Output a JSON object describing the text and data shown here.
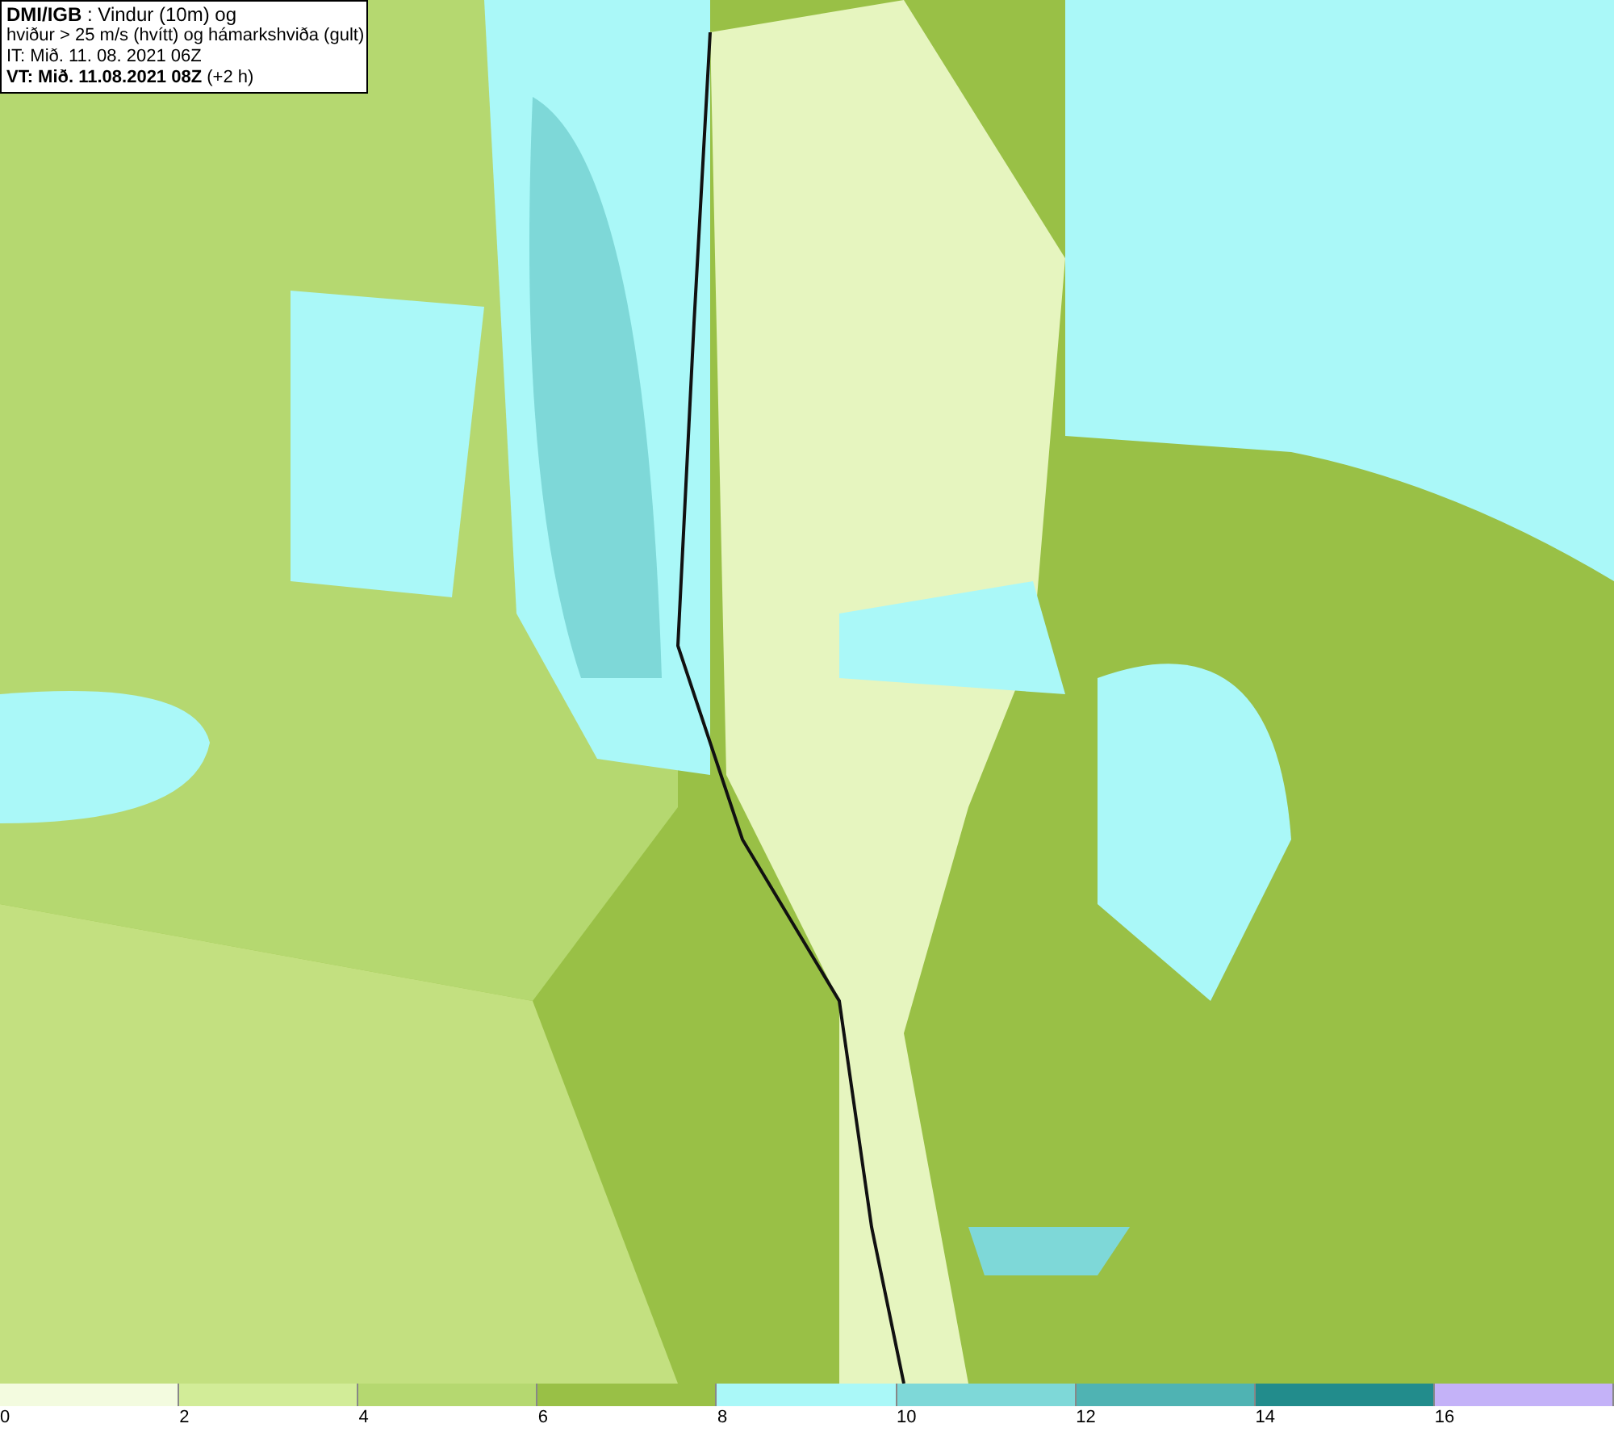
{
  "header": {
    "lines": [
      "**DMI/IGB** : Vindur (10m) og",
      "hviður > 25 m/s (hvítt) og hámarkshviða (gult)",
      "IT: Mið. 11. 08. 2021 06Z",
      "**VT: Mið. 11.08.2021 08Z** (+2 h)"
    ]
  },
  "legend": [
    {
      "label": "0",
      "color": "#f3fbdf"
    },
    {
      "label": "2",
      "color": "#d2ec98"
    },
    {
      "label": "4",
      "color": "#b5d870"
    },
    {
      "label": "6",
      "color": "#99c046"
    },
    {
      "label": "8",
      "color": "#aaf8f8"
    },
    {
      "label": "10",
      "color": "#7ed8d8"
    },
    {
      "label": "12",
      "color": "#4fb3b3"
    },
    {
      "label": "14",
      "color": "#228c8c"
    },
    {
      "label": "16",
      "color": "#c4b2f8"
    }
  ]
}
